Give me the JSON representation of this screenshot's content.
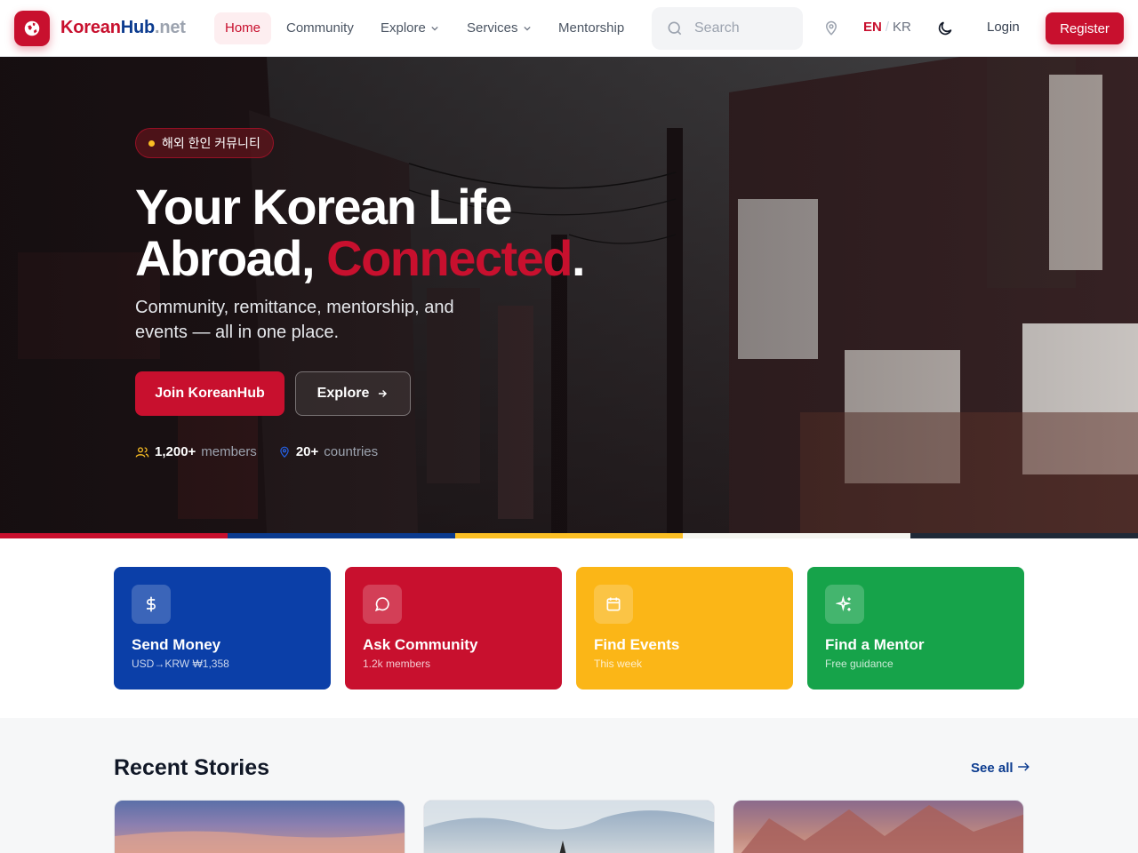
{
  "nav": {
    "brand": {
      "part1": "Korean",
      "part2": "Hub",
      "part3": ".net"
    },
    "items": [
      {
        "label": "Home",
        "active": true
      },
      {
        "label": "Community"
      },
      {
        "label": "Explore",
        "dropdown": true
      },
      {
        "label": "Services",
        "dropdown": true
      },
      {
        "label": "Mentorship"
      }
    ],
    "search_placeholder": "Search",
    "lang": {
      "en": "EN",
      "sep": "/",
      "kr": "KR"
    },
    "login": "Login",
    "register": "Register"
  },
  "hero": {
    "badge": "해외 한인 커뮤니티",
    "title_line1": "Your Korean Life",
    "title_line2_a": "Abroad, ",
    "title_line2_b": "Connected",
    "title_line2_c": ".",
    "subtitle": "Community, remittance, mentorship, and events — all in one place.",
    "join_button": "Join KoreanHub",
    "explore_button": "Explore",
    "stats": [
      {
        "value": "1,200+",
        "label": "members",
        "icon": "users-icon"
      },
      {
        "value": "20+",
        "label": "countries",
        "icon": "map-pin-icon"
      }
    ]
  },
  "stripe_colors": [
    "#c8102e",
    "#0b3b8f",
    "#fbbf24",
    "#f5f5f0",
    "#1f2937"
  ],
  "cards": [
    {
      "title": "Send Money",
      "subtitle": "USD→KRW ₩1,358",
      "color": "#0b3fa8",
      "icon": "dollar-icon"
    },
    {
      "title": "Ask Community",
      "subtitle": "1.2k members",
      "color": "#c8102e",
      "icon": "chat-icon"
    },
    {
      "title": "Find Events",
      "subtitle": "This week",
      "color": "#fbb617",
      "icon": "calendar-icon"
    },
    {
      "title": "Find a Mentor",
      "subtitle": "Free guidance",
      "color": "#16a34a",
      "icon": "sparkle-icon"
    }
  ],
  "stories": {
    "title": "Recent Stories",
    "see_all": "See all"
  },
  "colors": {
    "primary_red": "#c8102e",
    "primary_blue": "#0b3b8f"
  }
}
